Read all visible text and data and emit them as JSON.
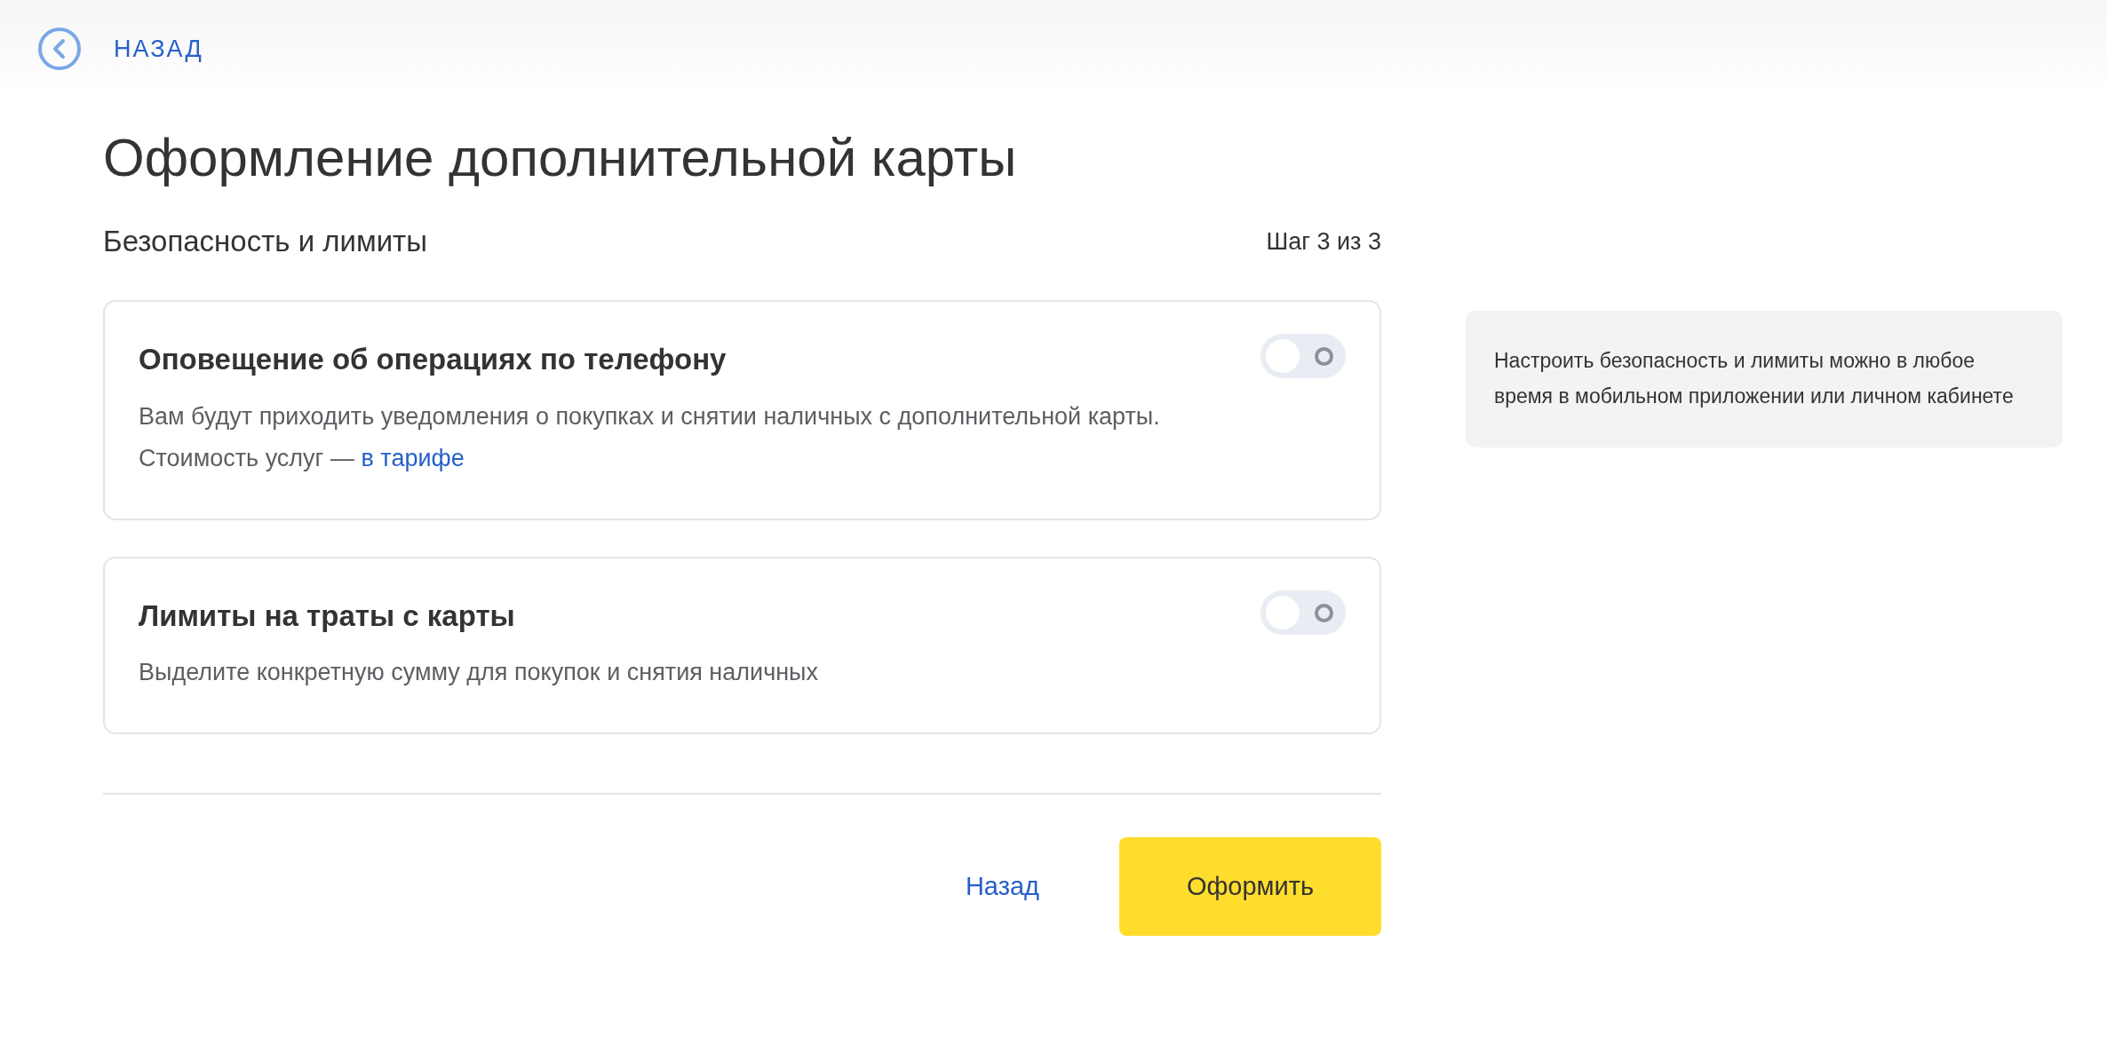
{
  "header": {
    "back_link": "НАЗАД"
  },
  "title": "Оформление дополнительной карты",
  "step": {
    "section": "Безопасность и лимиты",
    "counter": "Шаг 3 из 3"
  },
  "options": [
    {
      "title": "Оповещение об операциях по телефону",
      "description": "Вам будут приходить уведомления о покупках и снятии наличных с дополнительной карты. Стоимость услуг —",
      "link": "в тарифе",
      "on": false
    },
    {
      "title": "Лимиты на траты с карты",
      "description": "Выделите конкретную сумму для покупок и снятия наличных",
      "on": false
    }
  ],
  "actions": {
    "back": "Назад",
    "submit": "Оформить"
  },
  "aside": {
    "note": "Настроить безопасность и лимиты можно в любое время в мобильном приложении или личном кабинете"
  }
}
